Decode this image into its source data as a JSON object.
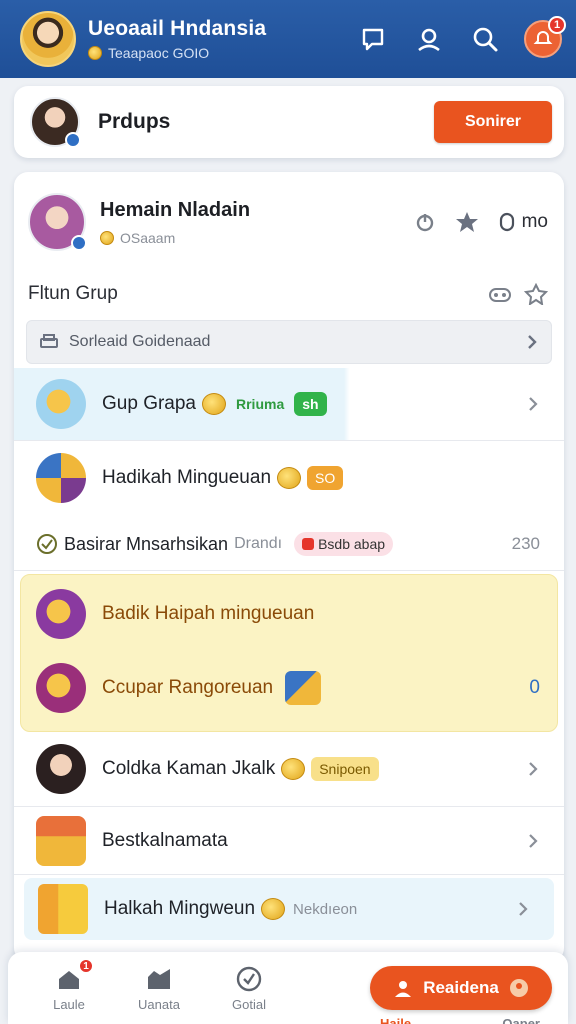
{
  "header": {
    "title": "Ueoaail Hndansia",
    "subtitle": "Teaapaoc GOIO",
    "notification_count": "1"
  },
  "top_card": {
    "name": "Prdups",
    "button_label": "Sonirer"
  },
  "profile": {
    "name": "Hemain Nladain",
    "subtitle": "OSaaam",
    "action_count": "mo"
  },
  "section": {
    "title": "Fltun Grup"
  },
  "search": {
    "label": "Sorleaid Goidenaad"
  },
  "items": [
    {
      "title": "Gup Grapa",
      "tag": "Rriuma",
      "tag2": "sh"
    },
    {
      "title": "Hadikah Mingueuan",
      "tag": "SO"
    },
    {
      "title": "Basirar Mnsarhsikan",
      "sub": "Drandı",
      "tag": "Bsdb abap",
      "value": "230"
    },
    {
      "title": "Badik Haipah mingueuan"
    },
    {
      "title": "Ccupar Rangoreuan",
      "value": "0"
    },
    {
      "title": "Coldka Kaman Jkalk",
      "tag": "Snipoen"
    },
    {
      "title": "Bestkalnamata"
    },
    {
      "title": "Halkah Mingweun",
      "sub": "Nekdıeon"
    }
  ],
  "bottom_nav": {
    "items": [
      {
        "label": "Laule",
        "badge": "1"
      },
      {
        "label": "Uanata"
      },
      {
        "label": "Gotial"
      }
    ],
    "cta_label": "Reaidena",
    "cta_sub_left": "Haile",
    "cta_sub_right": "Oaper"
  },
  "colors": {
    "header_blue": "#2a5ea8",
    "accent_orange": "#e9541f",
    "highlight_yellow": "#fbf3c4",
    "tag_green": "#31b34a"
  }
}
